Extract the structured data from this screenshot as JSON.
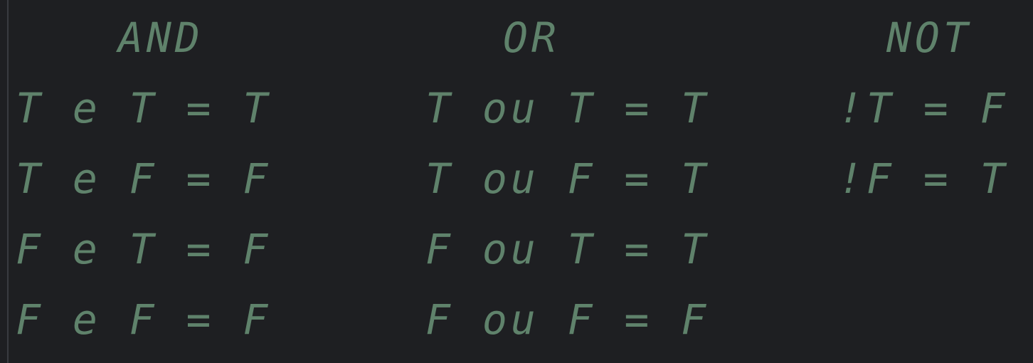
{
  "editor": {
    "text_color": "#5f826b",
    "background": "#1e1f22",
    "headers": {
      "and": "AND",
      "or": "OR",
      "not": "NOT"
    },
    "and_rows": [
      "T e T = T",
      "T e F = F",
      "F e T = F",
      "F e F = F"
    ],
    "or_rows": [
      "T ou T = T",
      "T ou F = T",
      "F ou T = T",
      "F ou F = F"
    ],
    "not_rows": [
      "!T = F",
      "!F = T"
    ]
  }
}
